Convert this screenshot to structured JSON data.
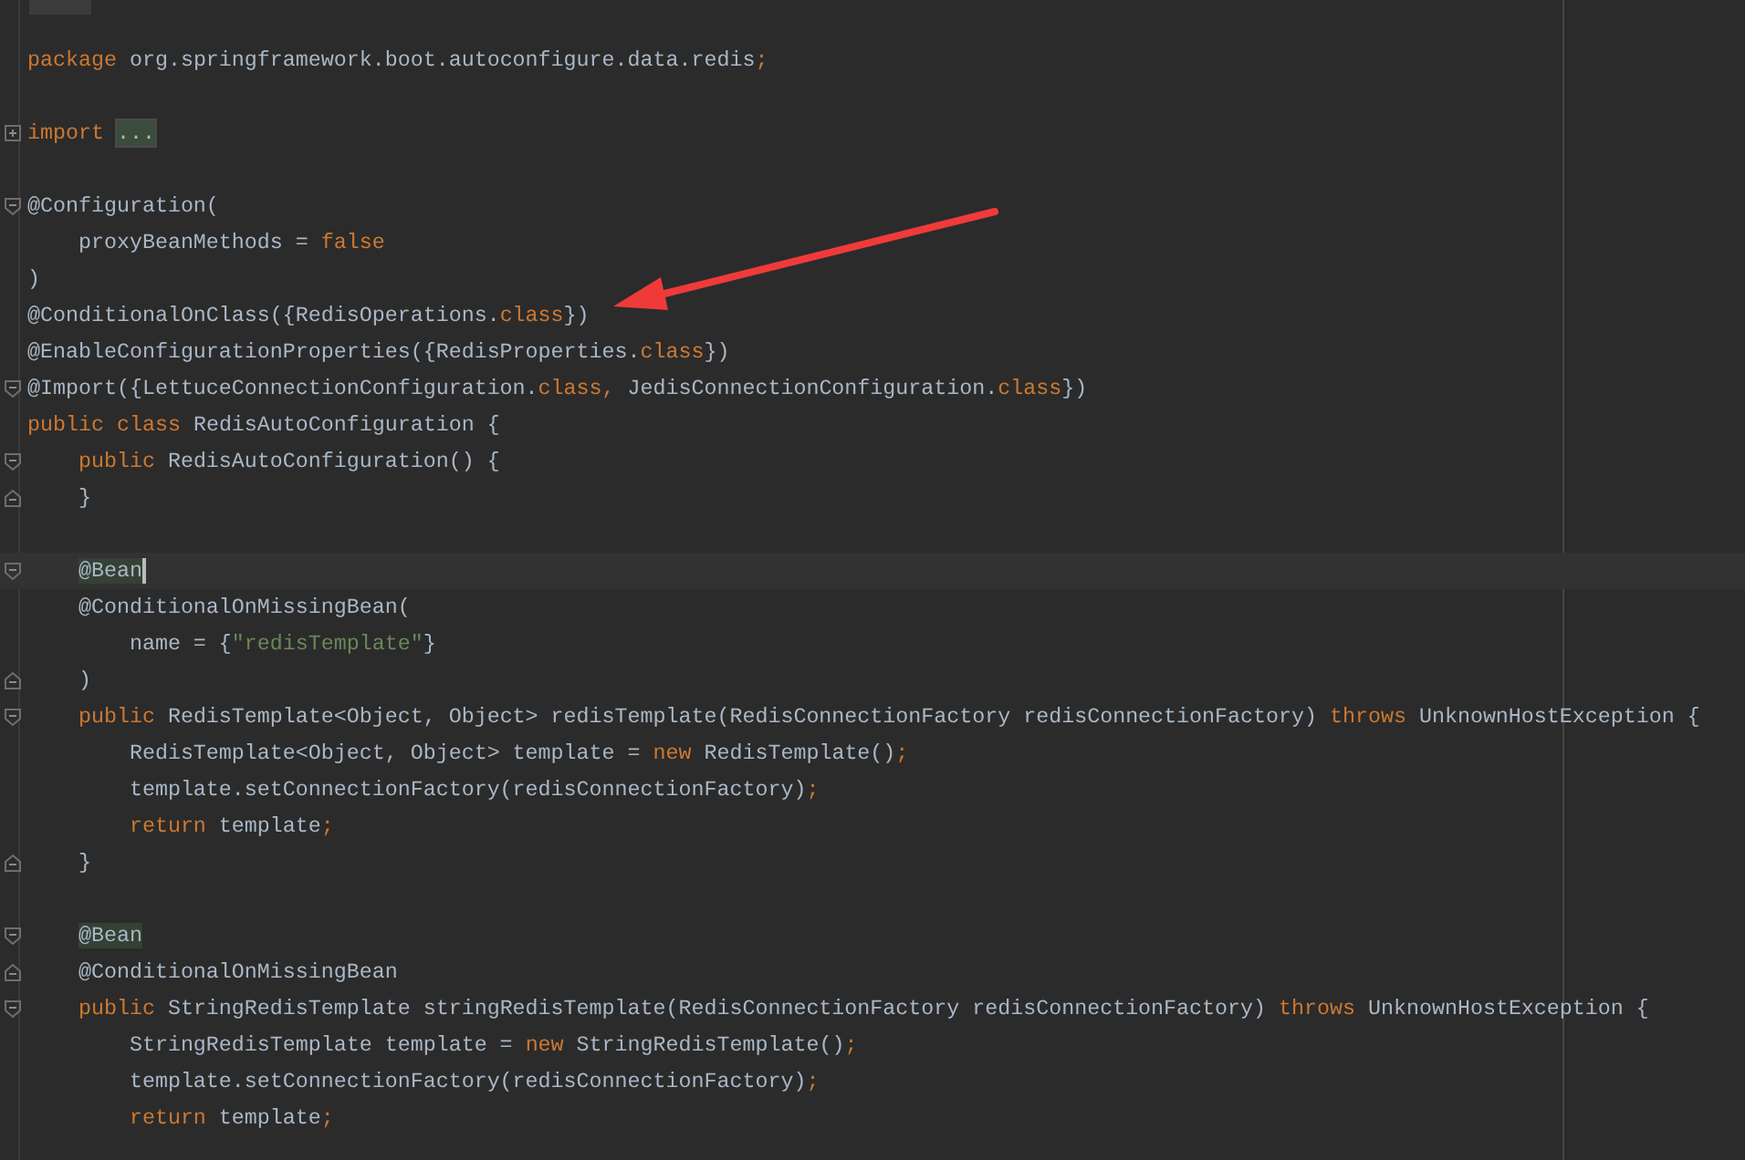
{
  "editor": {
    "lines": [
      {
        "kind": "code",
        "current": false,
        "tokens": [
          {
            "kind": "keyword",
            "text": "package"
          },
          {
            "kind": "plain",
            "text": " org.springframework.boot.autoconfigure.data.redis"
          },
          {
            "kind": "keyword",
            "text": ";"
          }
        ]
      },
      {
        "kind": "blank",
        "current": false
      },
      {
        "kind": "collapsed",
        "current": false,
        "tokens": [
          {
            "kind": "keyword",
            "text": "import "
          },
          {
            "kind": "folded",
            "text": "..."
          }
        ]
      },
      {
        "kind": "blank",
        "current": false
      },
      {
        "kind": "foldstart",
        "current": false,
        "tokens": [
          {
            "kind": "plain",
            "text": "@Configuration("
          }
        ]
      },
      {
        "kind": "code",
        "current": false,
        "tokens": [
          {
            "kind": "plain",
            "text": "    proxyBeanMethods = "
          },
          {
            "kind": "keyword",
            "text": "false"
          }
        ]
      },
      {
        "kind": "code",
        "current": false,
        "tokens": [
          {
            "kind": "plain",
            "text": ")"
          }
        ]
      },
      {
        "kind": "code",
        "current": false,
        "tokens": [
          {
            "kind": "plain",
            "text": "@ConditionalOnClass({RedisOperations."
          },
          {
            "kind": "keyword",
            "text": "class"
          },
          {
            "kind": "plain",
            "text": "})"
          }
        ]
      },
      {
        "kind": "code",
        "current": false,
        "tokens": [
          {
            "kind": "plain",
            "text": "@EnableConfigurationProperties({RedisProperties."
          },
          {
            "kind": "keyword",
            "text": "class"
          },
          {
            "kind": "plain",
            "text": "})"
          }
        ]
      },
      {
        "kind": "foldstart",
        "current": false,
        "tokens": [
          {
            "kind": "plain",
            "text": "@Import({LettuceConnectionConfiguration."
          },
          {
            "kind": "keyword",
            "text": "class, "
          },
          {
            "kind": "plain",
            "text": "JedisConnectionConfiguration."
          },
          {
            "kind": "keyword",
            "text": "class"
          },
          {
            "kind": "plain",
            "text": "})"
          }
        ]
      },
      {
        "kind": "code",
        "current": false,
        "tokens": [
          {
            "kind": "keyword",
            "text": "public class"
          },
          {
            "kind": "plain",
            "text": " RedisAutoConfiguration {"
          }
        ]
      },
      {
        "kind": "foldstart",
        "current": false,
        "tokens": [
          {
            "kind": "keyword",
            "text": "    public"
          },
          {
            "kind": "plain",
            "text": " RedisAutoConfiguration() {"
          }
        ]
      },
      {
        "kind": "foldend",
        "current": false,
        "tokens": [
          {
            "kind": "plain",
            "text": "    }"
          }
        ]
      },
      {
        "kind": "blank",
        "current": false
      },
      {
        "kind": "foldstart",
        "current": true,
        "tokens": [
          {
            "kind": "match",
            "text": "    @Bean"
          }
        ]
      },
      {
        "kind": "code",
        "current": false,
        "tokens": [
          {
            "kind": "plain",
            "text": "    @ConditionalOnMissingBean("
          }
        ]
      },
      {
        "kind": "code",
        "current": false,
        "tokens": [
          {
            "kind": "plain",
            "text": "        name = {"
          },
          {
            "kind": "string",
            "text": "\"redisTemplate\""
          },
          {
            "kind": "plain",
            "text": "}"
          }
        ]
      },
      {
        "kind": "foldend",
        "current": false,
        "tokens": [
          {
            "kind": "plain",
            "text": "    )"
          }
        ]
      },
      {
        "kind": "foldstart",
        "current": false,
        "tokens": [
          {
            "kind": "keyword",
            "text": "    public"
          },
          {
            "kind": "plain",
            "text": " RedisTemplate<Object, Object> redisTemplate(RedisConnectionFactory redisConnectionFactory) "
          },
          {
            "kind": "keyword",
            "text": "throws"
          },
          {
            "kind": "plain",
            "text": " UnknownHostException {"
          }
        ]
      },
      {
        "kind": "code",
        "current": false,
        "tokens": [
          {
            "kind": "plain",
            "text": "        RedisTemplate<Object, Object> template = "
          },
          {
            "kind": "keyword",
            "text": "new"
          },
          {
            "kind": "plain",
            "text": " RedisTemplate()"
          },
          {
            "kind": "keyword",
            "text": ";"
          }
        ]
      },
      {
        "kind": "code",
        "current": false,
        "tokens": [
          {
            "kind": "plain",
            "text": "        template.setConnectionFactory(redisConnectionFactory)"
          },
          {
            "kind": "keyword",
            "text": ";"
          }
        ]
      },
      {
        "kind": "code",
        "current": false,
        "tokens": [
          {
            "kind": "keyword",
            "text": "        return"
          },
          {
            "kind": "plain",
            "text": " template"
          },
          {
            "kind": "keyword",
            "text": ";"
          }
        ]
      },
      {
        "kind": "foldend",
        "current": false,
        "tokens": [
          {
            "kind": "plain",
            "text": "    }"
          }
        ]
      },
      {
        "kind": "blank",
        "current": false
      },
      {
        "kind": "foldstart",
        "current": false,
        "tokens": [
          {
            "kind": "match",
            "text": "    @Bean"
          }
        ]
      },
      {
        "kind": "foldend",
        "current": false,
        "tokens": [
          {
            "kind": "plain",
            "text": "    @ConditionalOnMissingBean"
          }
        ]
      },
      {
        "kind": "foldstart",
        "current": false,
        "tokens": [
          {
            "kind": "keyword",
            "text": "    public"
          },
          {
            "kind": "plain",
            "text": " StringRedisTemplate stringRedisTemplate(RedisConnectionFactory redisConnectionFactory) "
          },
          {
            "kind": "keyword",
            "text": "throws"
          },
          {
            "kind": "plain",
            "text": " UnknownHostException {"
          }
        ]
      },
      {
        "kind": "code",
        "current": false,
        "tokens": [
          {
            "kind": "plain",
            "text": "        StringRedisTemplate template = "
          },
          {
            "kind": "keyword",
            "text": "new"
          },
          {
            "kind": "plain",
            "text": " StringRedisTemplate()"
          },
          {
            "kind": "keyword",
            "text": ";"
          }
        ]
      },
      {
        "kind": "code",
        "current": false,
        "tokens": [
          {
            "kind": "plain",
            "text": "        template.setConnectionFactory(redisConnectionFactory)"
          },
          {
            "kind": "keyword",
            "text": ";"
          }
        ]
      },
      {
        "kind": "code",
        "current": false,
        "tokens": [
          {
            "kind": "keyword",
            "text": "        return"
          },
          {
            "kind": "plain",
            "text": " template"
          },
          {
            "kind": "keyword",
            "text": ";"
          }
        ]
      }
    ]
  }
}
